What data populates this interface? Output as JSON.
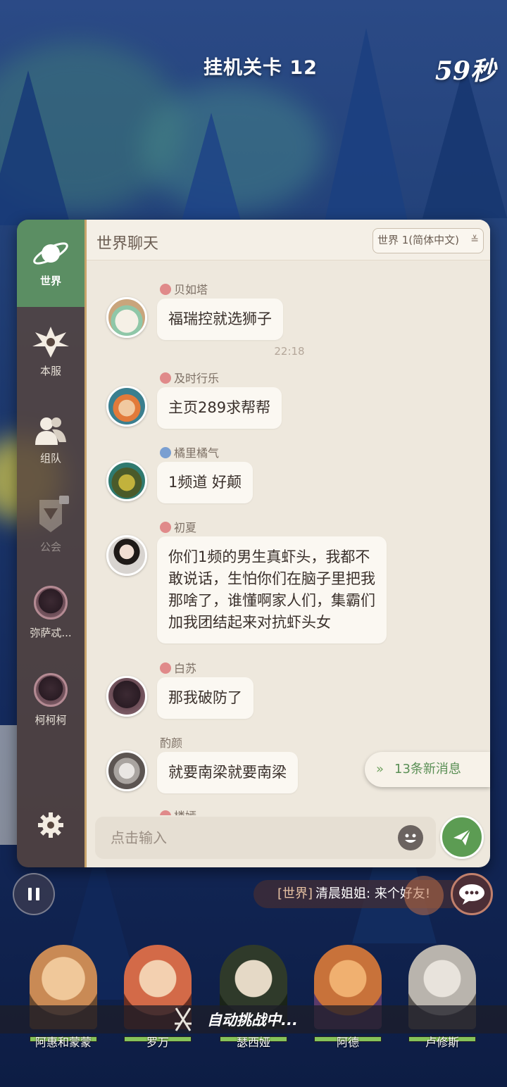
{
  "hud": {
    "stage_title": "挂机关卡 12",
    "timer": "59秒"
  },
  "sidebar": {
    "items": [
      {
        "label": "世界",
        "icon": "planet-icon",
        "active": true
      },
      {
        "label": "本服",
        "icon": "server-castle-icon",
        "active": false
      },
      {
        "label": "组队",
        "icon": "team-icon",
        "active": false
      },
      {
        "label": "公会",
        "icon": "guild-icon",
        "active": false,
        "locked": true
      },
      {
        "label": "弥萨忒...",
        "icon": "hooded-avatar",
        "active": false
      },
      {
        "label": "柯柯柯",
        "icon": "hooded-avatar",
        "active": false
      }
    ],
    "settings_icon": "gear-icon"
  },
  "chat": {
    "title": "世界聊天",
    "channel": "世界 1(简体中文)",
    "timestamp": "22:18",
    "messages": [
      {
        "name": "贝如塔",
        "gender": "female",
        "text": [
          "福瑞控就选狮子"
        ]
      },
      {
        "name": "及时行乐",
        "gender": "female",
        "text": [
          "主页289求帮帮"
        ]
      },
      {
        "name": "橘里橘气",
        "gender": "male",
        "text": [
          "1频道 好颠"
        ]
      },
      {
        "name": "初夏",
        "gender": "female",
        "text": [
          "你们1频的男生真虾头，我都不",
          "敢说话，生怕你们在脑子里把我",
          "那啥了，谁懂啊家人们，集霸们",
          "加我团结起来对抗虾头女"
        ]
      },
      {
        "name": "白苏",
        "gender": "female",
        "text": [
          "那我破防了"
        ]
      },
      {
        "name": "酌颜",
        "gender": "none",
        "text": [
          "就要南梁就要南梁"
        ]
      },
      {
        "name": "楼嫣",
        "gender": "female",
        "text": []
      }
    ],
    "new_messages": "13条新消息",
    "input_placeholder": "点击输入"
  },
  "ticker": {
    "tag": "[世界]",
    "text": "清晨姐姐: 来个好友!"
  },
  "heroes": [
    {
      "name": "阿惠和蒙蒙",
      "color": "#d8a06a"
    },
    {
      "name": "罗万",
      "color": "#d36a48"
    },
    {
      "name": "瑟西娅",
      "color": "#3e5a3a"
    },
    {
      "name": "阿德",
      "color": "#c8723a"
    },
    {
      "name": "卢修斯",
      "color": "#b9b4ad"
    }
  ],
  "status": {
    "auto_challenge": "自动挑战中..."
  },
  "colors": {
    "accent_green": "#5c9c53",
    "panel_bg": "#eee8dd",
    "sidebar_bg": "#58463e"
  }
}
